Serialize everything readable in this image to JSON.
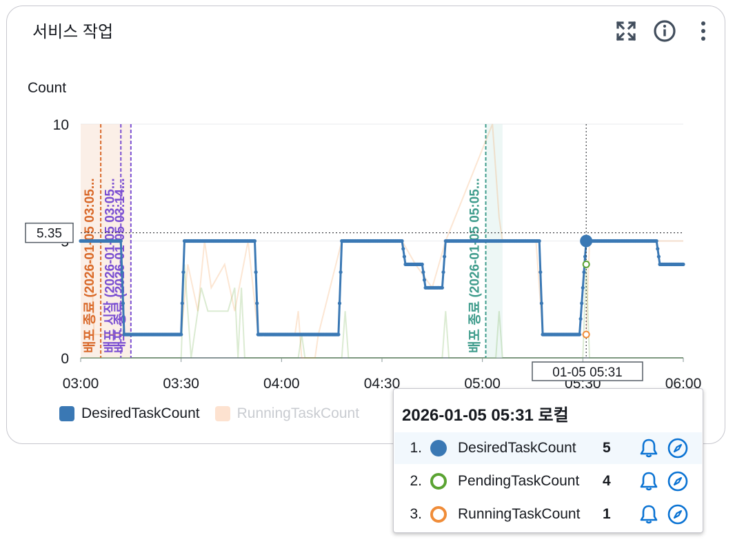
{
  "widget": {
    "title": "서비스 작업"
  },
  "icons": [
    "fullscreen-icon",
    "info-icon",
    "more-vert-icon",
    "bell-icon",
    "compass-icon"
  ],
  "colors": {
    "desired": "#3a78b4",
    "pending": "#5aa332",
    "running": "#f08c38",
    "deploy_orange": "#d9692a",
    "deploy_purple": "#7b4fd2",
    "deploy_green": "#3f9c8c",
    "tooltip_highlight": "#f2f8fd",
    "icon_blue": "#0972d3"
  },
  "chart_data": {
    "type": "line",
    "ylabel": "Count",
    "ylim": [
      0,
      10
    ],
    "yticks": [
      "0",
      "5",
      "10"
    ],
    "xlim": [
      "03:00",
      "06:00"
    ],
    "xticks": [
      "03:00",
      "03:30",
      "04:00",
      "04:30",
      "05:00",
      "05:30",
      "06:00"
    ],
    "grid": true,
    "legend_position": "bottom",
    "series": [
      {
        "name": "DesiredTaskCount",
        "points": [
          [
            "03:00",
            5
          ],
          [
            "03:12",
            5
          ],
          [
            "03:13",
            1
          ],
          [
            "03:30",
            1
          ],
          [
            "03:31",
            5
          ],
          [
            "03:52",
            5
          ],
          [
            "03:53",
            1
          ],
          [
            "04:17",
            1
          ],
          [
            "04:18",
            5
          ],
          [
            "04:36",
            5
          ],
          [
            "04:37",
            4
          ],
          [
            "04:42",
            4
          ],
          [
            "04:43",
            3
          ],
          [
            "04:48",
            3
          ],
          [
            "04:49",
            5
          ],
          [
            "05:17",
            5
          ],
          [
            "05:18",
            1
          ],
          [
            "05:29",
            1
          ],
          [
            "05:31",
            5
          ],
          [
            "05:52",
            5
          ],
          [
            "05:53",
            4
          ],
          [
            "06:00",
            4
          ]
        ]
      },
      {
        "name": "PendingTaskCount",
        "points": [
          [
            "03:00",
            0
          ],
          [
            "03:30",
            0
          ],
          [
            "03:31",
            4
          ],
          [
            "03:33",
            0
          ],
          [
            "03:36",
            3
          ],
          [
            "03:38",
            2
          ],
          [
            "03:44",
            2
          ],
          [
            "03:46",
            3
          ],
          [
            "03:47",
            0
          ],
          [
            "03:48",
            3
          ],
          [
            "03:49",
            0
          ],
          [
            "04:05",
            0
          ],
          [
            "04:06",
            1
          ],
          [
            "04:07",
            0
          ],
          [
            "04:18",
            0
          ],
          [
            "04:19",
            2
          ],
          [
            "04:20",
            0
          ],
          [
            "04:48",
            0
          ],
          [
            "04:49",
            2
          ],
          [
            "04:50",
            0
          ],
          [
            "05:04",
            0
          ],
          [
            "05:05",
            2
          ],
          [
            "05:06",
            0
          ],
          [
            "05:30",
            0
          ],
          [
            "05:31",
            4
          ],
          [
            "05:32",
            0
          ],
          [
            "06:00",
            0
          ]
        ]
      },
      {
        "name": "RunningTaskCount",
        "points": [
          [
            "03:00",
            5
          ],
          [
            "03:03",
            5
          ],
          [
            "03:04",
            1
          ],
          [
            "03:30",
            1
          ],
          [
            "03:32",
            4
          ],
          [
            "03:35",
            2
          ],
          [
            "03:37",
            5
          ],
          [
            "03:39",
            3
          ],
          [
            "03:43",
            4
          ],
          [
            "03:46",
            2
          ],
          [
            "03:50",
            5
          ],
          [
            "03:53",
            1
          ],
          [
            "04:04",
            1
          ],
          [
            "04:05",
            2
          ],
          [
            "04:06",
            0
          ],
          [
            "04:10",
            0
          ],
          [
            "04:11",
            1
          ],
          [
            "04:18",
            5
          ],
          [
            "04:36",
            5
          ],
          [
            "04:40",
            4
          ],
          [
            "04:45",
            3
          ],
          [
            "04:49",
            5
          ],
          [
            "05:03",
            10
          ],
          [
            "05:05",
            6
          ],
          [
            "05:06",
            5
          ],
          [
            "05:16",
            5
          ],
          [
            "05:18",
            1
          ],
          [
            "05:30",
            1
          ],
          [
            "05:31",
            1
          ],
          [
            "05:32",
            5
          ],
          [
            "06:00",
            5
          ]
        ]
      }
    ],
    "annotations": [
      {
        "label": "배포 종료 (2026-01-05 03:05...",
        "time": "03:06",
        "color": "deploy_orange"
      },
      {
        "label": "배포 시작 (2026-01-05 03:05...",
        "time": "03:12",
        "color": "deploy_purple"
      },
      {
        "label": "배포 종료 (2026-01-05 03:14...",
        "time": "03:15",
        "color": "deploy_purple"
      },
      {
        "label": "배포 종료 (2026-01-05 05:05...",
        "time": "05:01",
        "color": "deploy_green"
      }
    ],
    "crosshair": {
      "x_label": "01-05 05:31",
      "y_label": "5.35",
      "time": "05:31",
      "y": 5.35
    }
  },
  "tooltip": {
    "title": "2026-01-05 05:31 로컬",
    "rows": [
      {
        "index": "1.",
        "name": "DesiredTaskCount",
        "value": "5"
      },
      {
        "index": "2.",
        "name": "PendingTaskCount",
        "value": "4"
      },
      {
        "index": "3.",
        "name": "RunningTaskCount",
        "value": "1"
      }
    ]
  }
}
